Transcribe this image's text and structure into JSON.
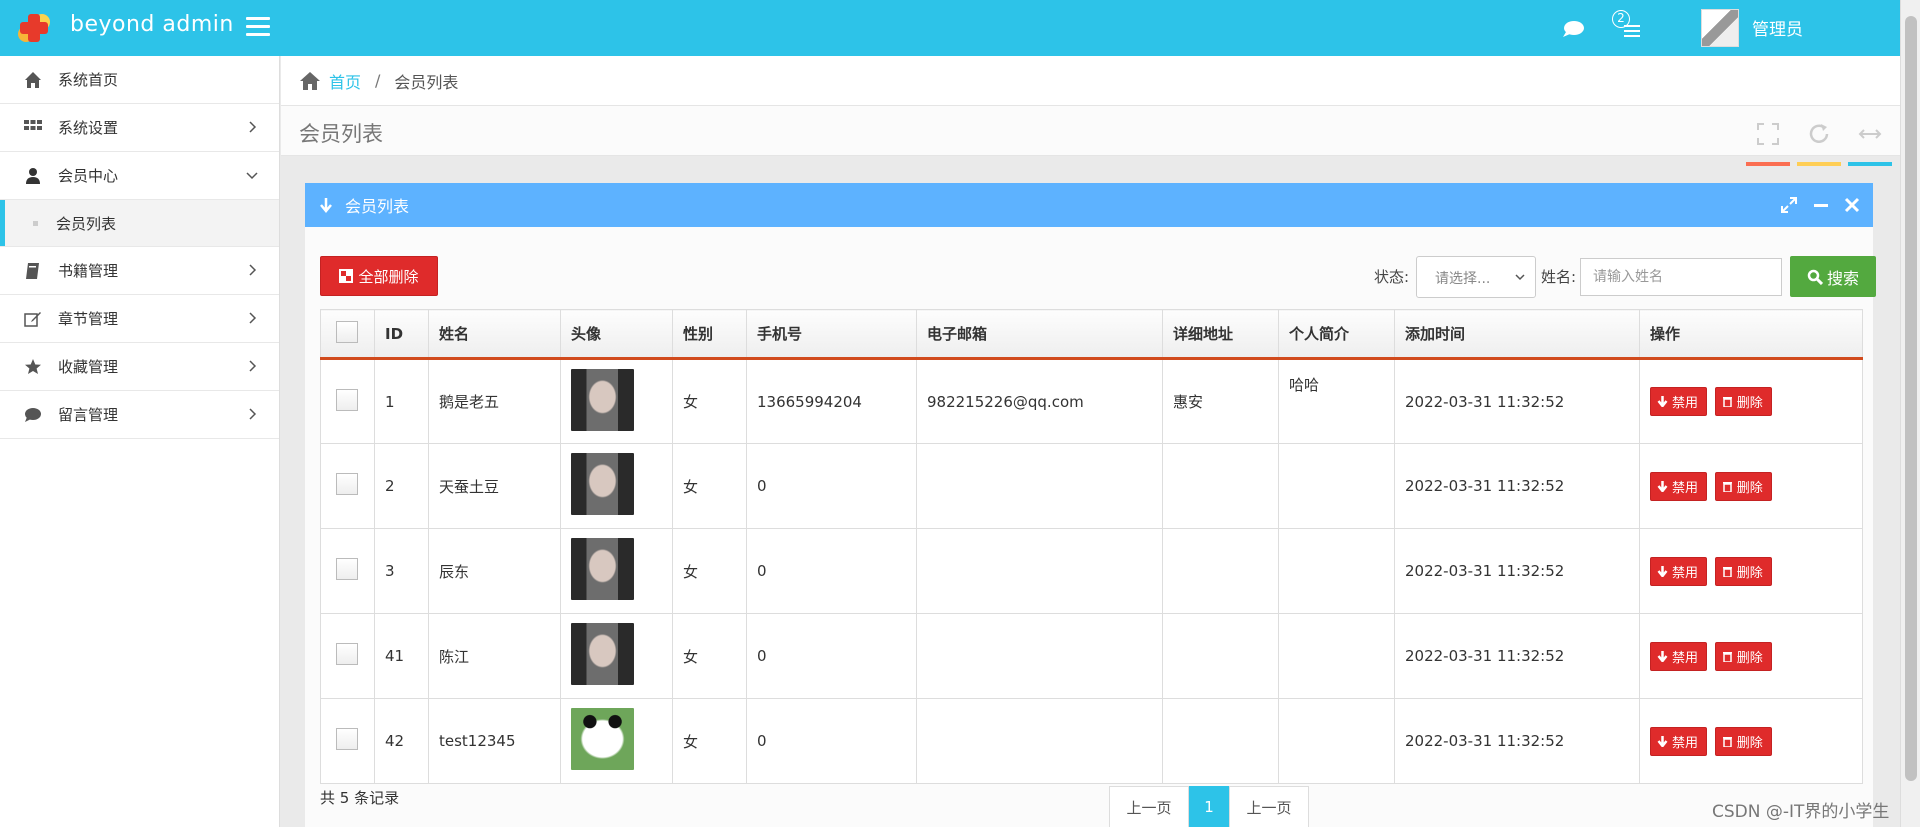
{
  "topbar": {
    "logo_text": "beyond admin",
    "task_count": "2",
    "user_name": "管理员",
    "color": "#2dc3e8"
  },
  "sidebar": {
    "items": [
      {
        "label": "系统首页",
        "icon": "home-icon"
      },
      {
        "label": "系统设置",
        "icon": "grid-icon"
      },
      {
        "label": "会员中心",
        "icon": "user-icon"
      },
      {
        "label": "会员列表"
      },
      {
        "label": "书籍管理",
        "icon": "book-icon"
      },
      {
        "label": "章节管理",
        "icon": "edit-icon"
      },
      {
        "label": "收藏管理",
        "icon": "star-icon"
      },
      {
        "label": "留言管理",
        "icon": "comment-icon"
      }
    ]
  },
  "breadcrumb": {
    "home": "首页",
    "separator": "/",
    "current": "会员列表"
  },
  "page": {
    "title": "会员列表"
  },
  "widget": {
    "title": "会员列表",
    "color": "#5db2ff"
  },
  "toolbar": {
    "delete_all": "全部删除",
    "status_label": "状态:",
    "status_value": "请选择...",
    "name_label": "姓名:",
    "name_placeholder": "请输入姓名",
    "search": "搜索"
  },
  "table": {
    "headers": [
      "ID",
      "姓名",
      "头像",
      "性别",
      "手机号",
      "电子邮箱",
      "详细地址",
      "个人简介",
      "添加时间",
      "操作"
    ],
    "rows": [
      {
        "id": "1",
        "name": "鹅是老五",
        "avatar": "girl",
        "gender": "女",
        "phone": "13665994204",
        "email": "982215226@qq.com",
        "address": "惠安",
        "intro": "哈哈",
        "time": "2022-03-31 11:32:52"
      },
      {
        "id": "2",
        "name": "天蚕土豆",
        "avatar": "girl",
        "gender": "女",
        "phone": "0",
        "email": "",
        "address": "",
        "intro": "",
        "time": "2022-03-31 11:32:52"
      },
      {
        "id": "3",
        "name": "辰东",
        "avatar": "girl",
        "gender": "女",
        "phone": "0",
        "email": "",
        "address": "",
        "intro": "",
        "time": "2022-03-31 11:32:52"
      },
      {
        "id": "41",
        "name": "陈江",
        "avatar": "girl",
        "gender": "女",
        "phone": "0",
        "email": "",
        "address": "",
        "intro": "",
        "time": "2022-03-31 11:32:52"
      },
      {
        "id": "42",
        "name": "test12345",
        "avatar": "panda",
        "gender": "女",
        "phone": "0",
        "email": "",
        "address": "",
        "intro": "",
        "time": "2022-03-31 11:32:52"
      }
    ],
    "disable_label": "禁用",
    "delete_label": "删除"
  },
  "footer": {
    "count": "共 5 条记录",
    "prev": "上一页",
    "current_page": "1",
    "next": "上一页"
  },
  "watermark": "CSDN @-IT界的小学生",
  "colors": {
    "danger": "#df2b2b",
    "success": "#53a93f",
    "accent_orange": "#d14b1d"
  }
}
